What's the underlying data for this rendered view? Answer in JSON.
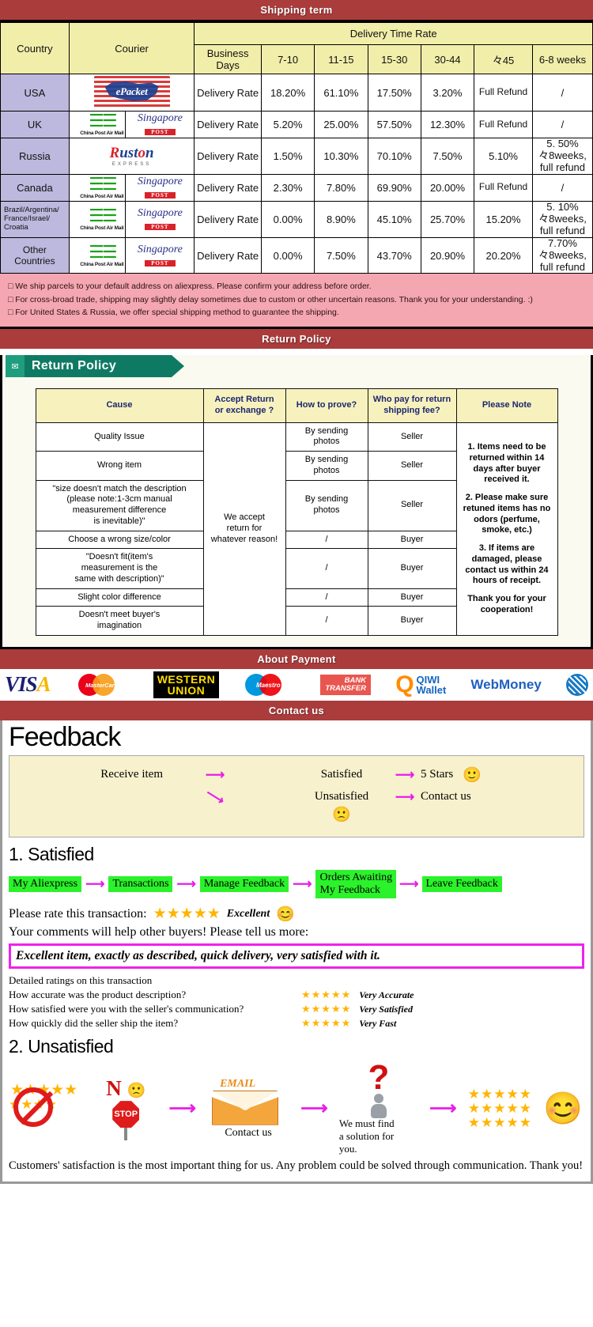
{
  "bands": {
    "shipping": "Shipping term",
    "return": "Return Policy",
    "payment": "About Payment",
    "contact": "Contact us"
  },
  "shipping": {
    "headers": {
      "country": "Country",
      "courier": "Courier",
      "delivery_time_rate": "Delivery Time Rate",
      "business_days": "Business Days",
      "cols": [
        "7-10",
        "11-15",
        "15-30",
        "30-44",
        "々45",
        "6-8 weeks"
      ]
    },
    "rate_label": "Delivery Rate",
    "rows": [
      {
        "country": "USA",
        "couriers": [
          "epacket"
        ],
        "values": [
          "18.20%",
          "61.10%",
          "17.50%",
          "3.20%",
          "Full Refund",
          "/"
        ],
        "last_note": ""
      },
      {
        "country": "UK",
        "couriers": [
          "china-post",
          "singapore-post"
        ],
        "values": [
          "5.20%",
          "25.00%",
          "57.50%",
          "12.30%",
          "Full Refund",
          "/"
        ],
        "last_note": ""
      },
      {
        "country": "Russia",
        "couriers": [
          "ruston"
        ],
        "values": [
          "1.50%",
          "10.30%",
          "70.10%",
          "7.50%",
          "5.10%",
          ""
        ],
        "last_note": "5. 50%\n々8weeks,\nfull refund"
      },
      {
        "country": "Canada",
        "couriers": [
          "china-post",
          "singapore-post"
        ],
        "values": [
          "2.30%",
          "7.80%",
          "69.90%",
          "20.00%",
          "Full Refund",
          "/"
        ],
        "last_note": ""
      },
      {
        "country": "Brazil/Argentina/\nFrance/Israel/\nCroatia",
        "couriers": [
          "china-post",
          "singapore-post"
        ],
        "values": [
          "0.00%",
          "8.90%",
          "45.10%",
          "25.70%",
          "15.20%",
          ""
        ],
        "last_note": "5. 10%\n々8weeks,\nfull refund"
      },
      {
        "country": "Other Countries",
        "couriers": [
          "china-post",
          "singapore-post"
        ],
        "values": [
          "0.00%",
          "7.50%",
          "43.70%",
          "20.90%",
          "20.20%",
          ""
        ],
        "last_note": "7.70%\n々8weeks,\nfull refund"
      }
    ],
    "notes": [
      "We ship parcels to your default address on aliexpress. Please confirm your address before order.",
      "For cross-broad trade, shipping may slightly delay sometimes due to custom or other uncertain reasons. Thank you for your understanding. :)",
      "For United States & Russia, we offer special shipping method to guarantee the shipping."
    ]
  },
  "return_policy": {
    "ribbon_label": "Return Policy",
    "headers": [
      "Cause",
      "Accept Return\nor exchange ?",
      "How to prove?",
      "Who pay for return\nshipping fee?",
      "Please Note"
    ],
    "accept_text": "We accept\nreturn for\nwhatever reason!",
    "rows": [
      {
        "cause": "Quality Issue",
        "prove": "By sending\nphotos",
        "pays": "Seller"
      },
      {
        "cause": "Wrong item",
        "prove": "By sending\nphotos",
        "pays": "Seller"
      },
      {
        "cause": "\"size doesn't match the description\n(please note:1-3cm manual\nmeasurement difference\nis inevitable)\"",
        "prove": "By sending\nphotos",
        "pays": "Seller"
      },
      {
        "cause": "Choose a wrong size/color",
        "prove": "/",
        "pays": "Buyer"
      },
      {
        "cause": "\"Doesn't fit(item's\nmeasurement is the\nsame with description)\"",
        "prove": "/",
        "pays": "Buyer"
      },
      {
        "cause": "Slight color difference",
        "prove": "/",
        "pays": "Buyer"
      },
      {
        "cause": "Doesn't meet buyer's\nimagination",
        "prove": "/",
        "pays": "Buyer"
      }
    ],
    "notes": [
      "1. Items need to be returned within 14 days after buyer received it.",
      "2. Please make sure retuned items has no odors (perfume, smoke, etc.)",
      "3. If items are damaged, please contact us within 24 hours of receipt.",
      "Thank you for your cooperation!"
    ]
  },
  "payment": {
    "methods": [
      {
        "name": "VISA",
        "id": "visa-logo"
      },
      {
        "name": "MasterCard",
        "id": "mastercard-logo"
      },
      {
        "name": "WESTERN UNION",
        "line1": "WESTERN",
        "line2": "UNION",
        "id": "western-union-logo"
      },
      {
        "name": "Maestro",
        "id": "maestro-logo"
      },
      {
        "name": "BANK TRANSFER",
        "line1": "BANK",
        "line2": "TRANSFER",
        "id": "bank-transfer-logo"
      },
      {
        "name": "QIWI Wallet",
        "line1": "QIWI",
        "line2": "Wallet",
        "id": "qiwi-wallet-logo"
      },
      {
        "name": "WebMoney",
        "id": "webmoney-logo"
      }
    ]
  },
  "feedback": {
    "title": "Feedback",
    "flow": {
      "receive": "Receive item",
      "satisfied": "Satisfied",
      "five_stars": "5 Stars",
      "unsatisfied": "Unsatisfied",
      "contact_us": "Contact us",
      "happy_emoji": "🙂",
      "sad_emoji": "🙁"
    },
    "satisfied": {
      "heading": "1. Satisfied",
      "steps": [
        "My Aliexpress",
        "Transactions",
        "Manage Feedback",
        "Orders Awaiting\nMy Feedback",
        "Leave Feedback"
      ],
      "rate_prompt": "Please rate this transaction:",
      "stars": "★★★★★",
      "rating_word": "Excellent",
      "comment_prompt": "Your comments will help other buyers! Please tell us more:",
      "comment_text": "Excellent item, exactly as described, quick delivery, very satisfied with it.",
      "detailed_heading": "Detailed ratings on this transaction",
      "detailed": [
        {
          "question": "How accurate was the product description?",
          "stars": "★★★★★",
          "value": "Very Accurate"
        },
        {
          "question": "How satisfied were you with the seller's communication?",
          "stars": "★★★★★",
          "value": "Very Satisfied"
        },
        {
          "question": "How quickly did the seller ship the item?",
          "stars": "★★★★★",
          "value": "Very Fast"
        }
      ]
    },
    "unsatisfied": {
      "heading": "2. Unsatisfied",
      "no_label": "N",
      "stop_label": "STOP",
      "email_label": "EMAIL",
      "contact_caption": "Contact us",
      "solution_caption": "We must find\na solution for\nyou.",
      "stars_block": "★★★★★",
      "smile_emoji": "😊",
      "closing": "Customers' satisfaction is the most important thing for us. Any problem could be solved through communication. Thank you!"
    }
  },
  "colors": {
    "band": "#aa3c3c",
    "header_yellow": "#f1eeaa",
    "country_purple": "#bdb8dd",
    "notes_pink": "#f4a7b1",
    "green_step": "#2bf22b",
    "magenta": "#ee22ee",
    "star_gold": "#ffb400"
  }
}
